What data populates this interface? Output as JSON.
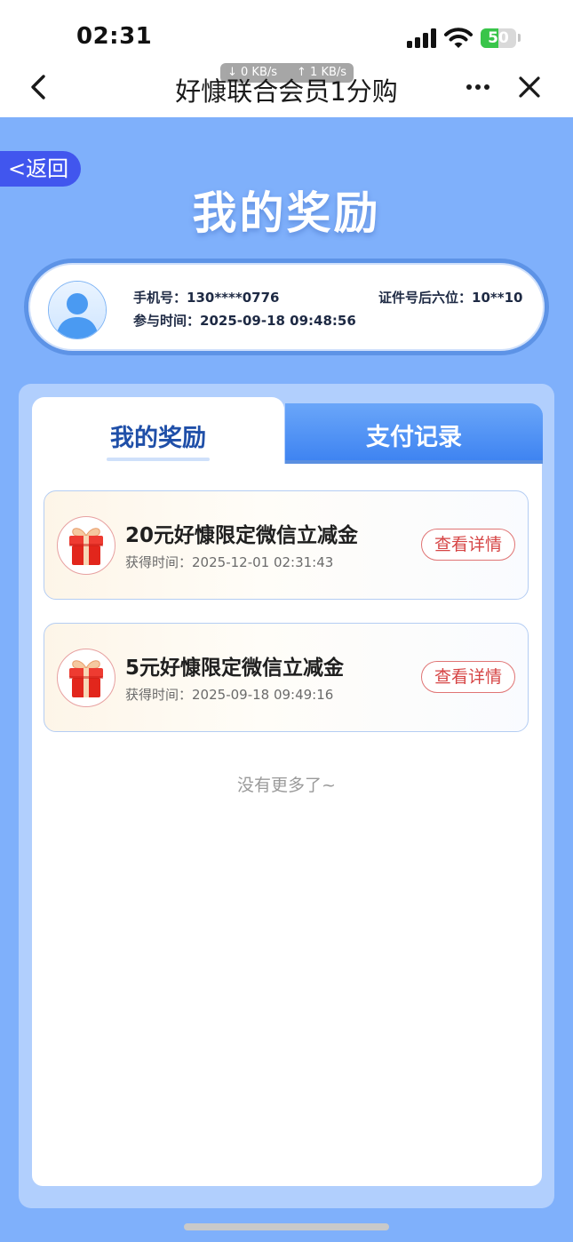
{
  "status_bar": {
    "time": "02:31",
    "battery": "50",
    "battery_level": 0.5,
    "net_down": "↓ 0 KB/s",
    "net_up": "↑ 1 KB/s",
    "icons": [
      "signal-icon",
      "wifi-icon",
      "battery-icon"
    ]
  },
  "nav": {
    "title": "好慷联合会员1分购",
    "icons": [
      "back-chevron-icon",
      "more-icon",
      "close-icon"
    ]
  },
  "header": {
    "back_label": "<返回",
    "page_title": "我的奖励"
  },
  "user": {
    "phone_label": "手机号：",
    "phone": "130****0776",
    "id_label": "证件号后六位：",
    "id_value": "10**10",
    "join_label": "参与时间：",
    "join_time": "2025-09-18 09:48:56"
  },
  "tabs": [
    {
      "label": "我的奖励",
      "active": true
    },
    {
      "label": "支付记录",
      "active": false
    }
  ],
  "rewards": [
    {
      "title": "20元好慷限定微信立减金",
      "time_label": "获得时间：",
      "time": "2025-12-01 02:31:43",
      "button": "查看详情"
    },
    {
      "title": "5元好慷限定微信立减金",
      "time_label": "获得时间：",
      "time": "2025-09-18 09:49:16",
      "button": "查看详情"
    }
  ],
  "footer": {
    "no_more": "没有更多了~"
  },
  "colors": {
    "page_bg": "#7fb0fb",
    "panel_bg": "#b1cffd",
    "accent_blue": "#1f4fa8",
    "back_pill": "#4156ee",
    "tab_inactive": "#3f84f1",
    "detail_red": "#d64545",
    "battery_green": "#39c54a"
  }
}
